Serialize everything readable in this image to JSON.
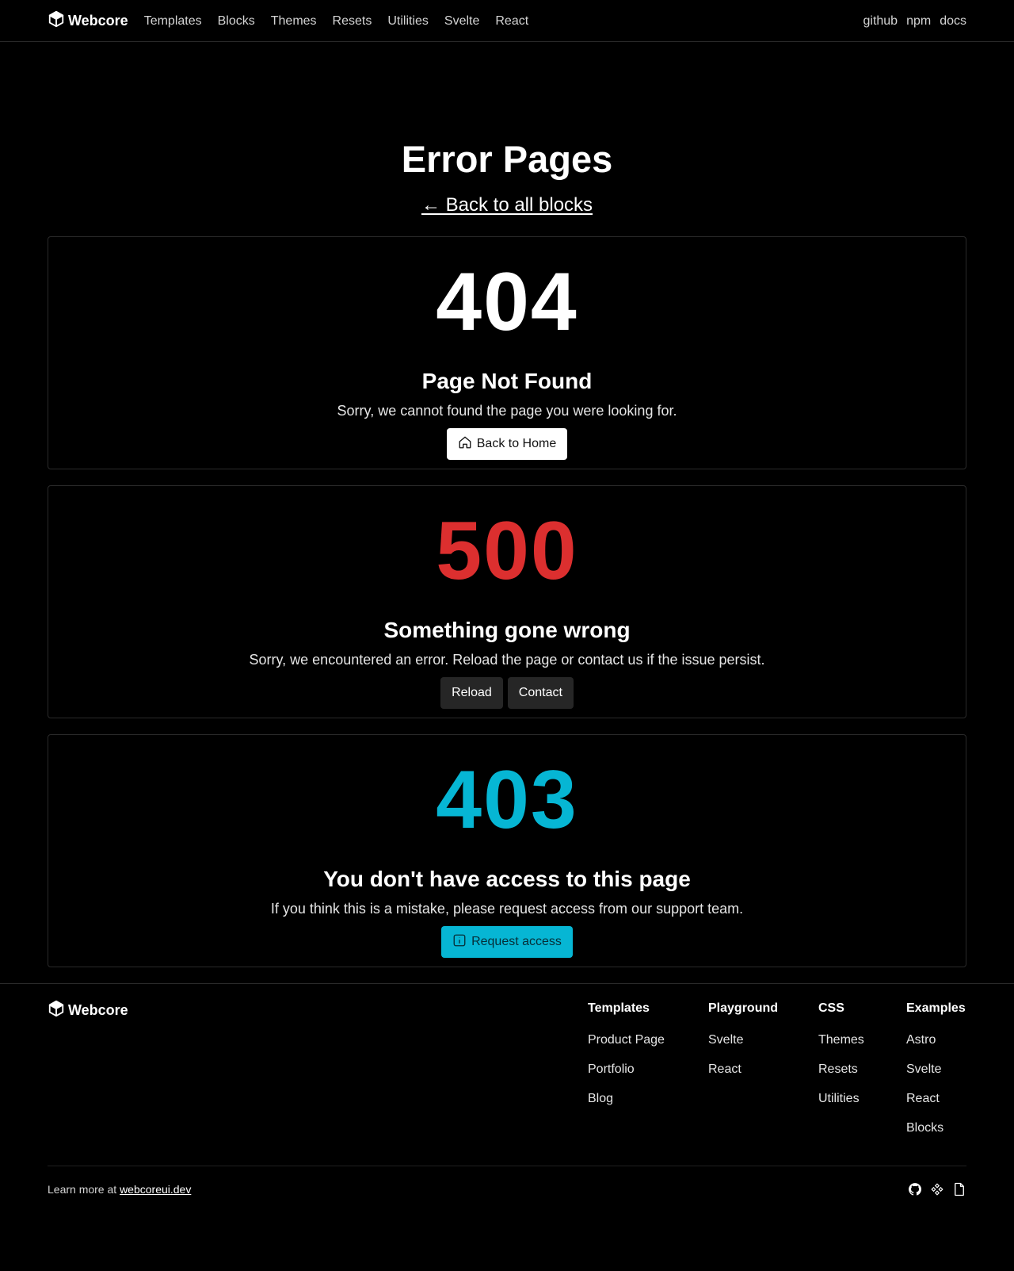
{
  "header": {
    "brand": "Webcore",
    "nav": [
      "Templates",
      "Blocks",
      "Themes",
      "Resets",
      "Utilities",
      "Svelte",
      "React"
    ],
    "right_links": [
      "github",
      "npm",
      "docs"
    ]
  },
  "hero": {
    "title": "Error Pages",
    "back_link": "← Back to all blocks"
  },
  "cards": [
    {
      "code": "404",
      "code_color": "#ffffff",
      "title": "Page Not Found",
      "description": "Sorry, we cannot found the page you were looking for.",
      "buttons": [
        {
          "label": "Back to Home",
          "icon": "home-icon"
        }
      ]
    },
    {
      "code": "500",
      "code_color": "#dc2f2f",
      "title": "Something gone wrong",
      "description": "Sorry, we encountered an error. Reload the page or contact us if the issue persist.",
      "buttons": [
        {
          "label": "Reload"
        },
        {
          "label": "Contact"
        }
      ]
    },
    {
      "code": "403",
      "code_color": "#06b6d4",
      "title": "You don't have access to this page",
      "description": "If you think this is a mistake, please request access from our support team.",
      "buttons": [
        {
          "label": "Request access",
          "icon": "info-icon"
        }
      ]
    }
  ],
  "footer": {
    "brand": "Webcore",
    "columns": [
      {
        "heading": "Templates",
        "links": [
          "Product Page",
          "Portfolio",
          "Blog"
        ]
      },
      {
        "heading": "Playground",
        "links": [
          "Svelte",
          "React"
        ]
      },
      {
        "heading": "CSS",
        "links": [
          "Themes",
          "Resets",
          "Utilities"
        ]
      },
      {
        "heading": "Examples",
        "links": [
          "Astro",
          "Svelte",
          "React",
          "Blocks"
        ]
      }
    ],
    "learn_prefix": "Learn more at ",
    "learn_link": "webcoreui.dev",
    "social_icons": [
      "github-icon",
      "figma-icon",
      "file-icon"
    ]
  }
}
